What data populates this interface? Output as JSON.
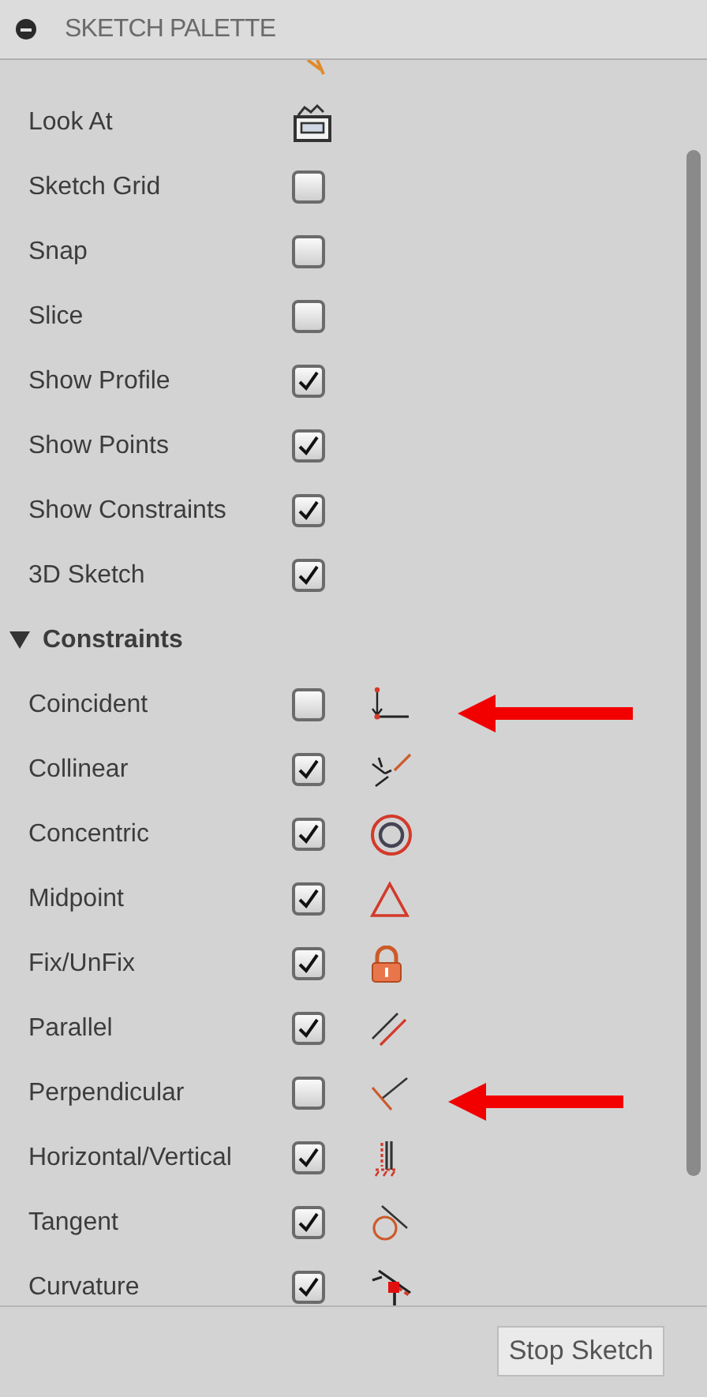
{
  "palette": {
    "title": "SKETCH PALETTE",
    "expanded": true
  },
  "options": [
    {
      "label": "Look At",
      "kind": "button"
    },
    {
      "label": "Sketch Grid",
      "kind": "checkbox",
      "checked": false
    },
    {
      "label": "Snap",
      "kind": "checkbox",
      "checked": false
    },
    {
      "label": "Slice",
      "kind": "checkbox",
      "checked": false
    },
    {
      "label": "Show Profile",
      "kind": "checkbox",
      "checked": true
    },
    {
      "label": "Show Points",
      "kind": "checkbox",
      "checked": true
    },
    {
      "label": "Show Constraints",
      "kind": "checkbox",
      "checked": true
    },
    {
      "label": "3D Sketch",
      "kind": "checkbox",
      "checked": true
    }
  ],
  "constraints_section": {
    "title": "Constraints",
    "expanded": true
  },
  "constraints": [
    {
      "label": "Coincident",
      "checked": false
    },
    {
      "label": "Collinear",
      "checked": true
    },
    {
      "label": "Concentric",
      "checked": true
    },
    {
      "label": "Midpoint",
      "checked": true
    },
    {
      "label": "Fix/UnFix",
      "checked": true
    },
    {
      "label": "Parallel",
      "checked": true
    },
    {
      "label": "Perpendicular",
      "checked": false
    },
    {
      "label": "Horizontal/Vertical",
      "checked": true
    },
    {
      "label": "Tangent",
      "checked": true
    },
    {
      "label": "Curvature",
      "checked": true
    }
  ],
  "footer": {
    "button": "Stop Sketch"
  }
}
